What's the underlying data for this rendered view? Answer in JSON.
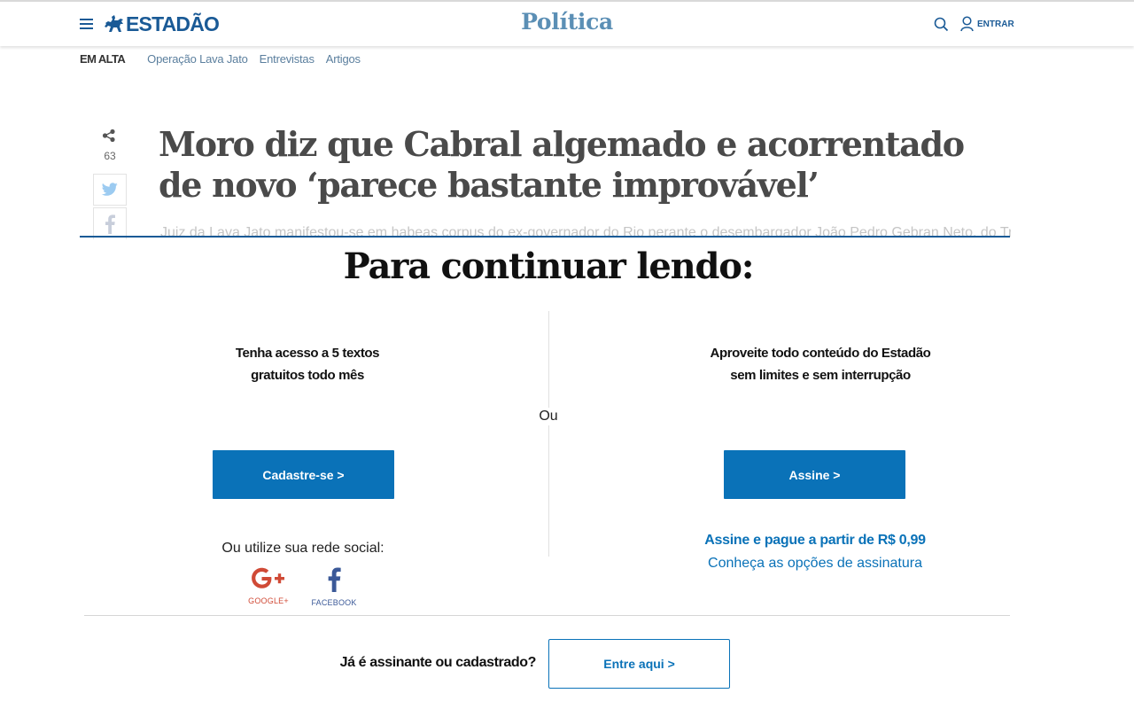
{
  "header": {
    "logo_text": "ESTADÃO",
    "section_title": "Política",
    "login_label": "ENTRAR",
    "icons": {
      "menu": "menu-icon",
      "logo_mark": "horse-rider-logo",
      "search": "search-icon",
      "user": "user-icon"
    }
  },
  "trending": {
    "label": "EM ALTA",
    "links": [
      "Operação Lava Jato",
      "Entrevistas",
      "Artigos"
    ]
  },
  "share": {
    "count": "63",
    "networks": [
      "twitter-icon",
      "facebook-icon"
    ]
  },
  "article": {
    "headline": "Moro diz que Cabral algemado e acorrentado de novo ‘parece bastante improvável’",
    "lead": "Juiz da Lava Jato manifestou-se em habeas corpus do ex-governador do Rio perante o desembargador João Pedro Gebran Neto, do Tribunal"
  },
  "paywall": {
    "title": "Para continuar lendo:",
    "or_label": "Ou",
    "left": {
      "text_line1": "Tenha acesso a 5 textos",
      "text_line2": "gratuitos todo mês",
      "button": "Cadastre-se >",
      "social_label": "Ou utilize sua rede social:",
      "google_caption": "GOOGLE+",
      "facebook_caption": "FACEBOOK"
    },
    "right": {
      "text_line1": "Aproveite todo conteúdo do Estadão",
      "text_line2": "sem limites e sem interrupção",
      "button": "Assine >",
      "price_line": "Assine e pague a partir de R$ 0,99",
      "options_link": "Conheça as opções de assinatura"
    },
    "footer": {
      "question": "Já é assinante ou cadastrado?",
      "button": "Entre aqui >"
    }
  },
  "colors": {
    "brand_blue": "#1a5a96",
    "section_blue": "#5b8fb5",
    "cta_blue": "#0a72b8",
    "google_red": "#d04a36",
    "facebook_blue": "#3b5998"
  }
}
